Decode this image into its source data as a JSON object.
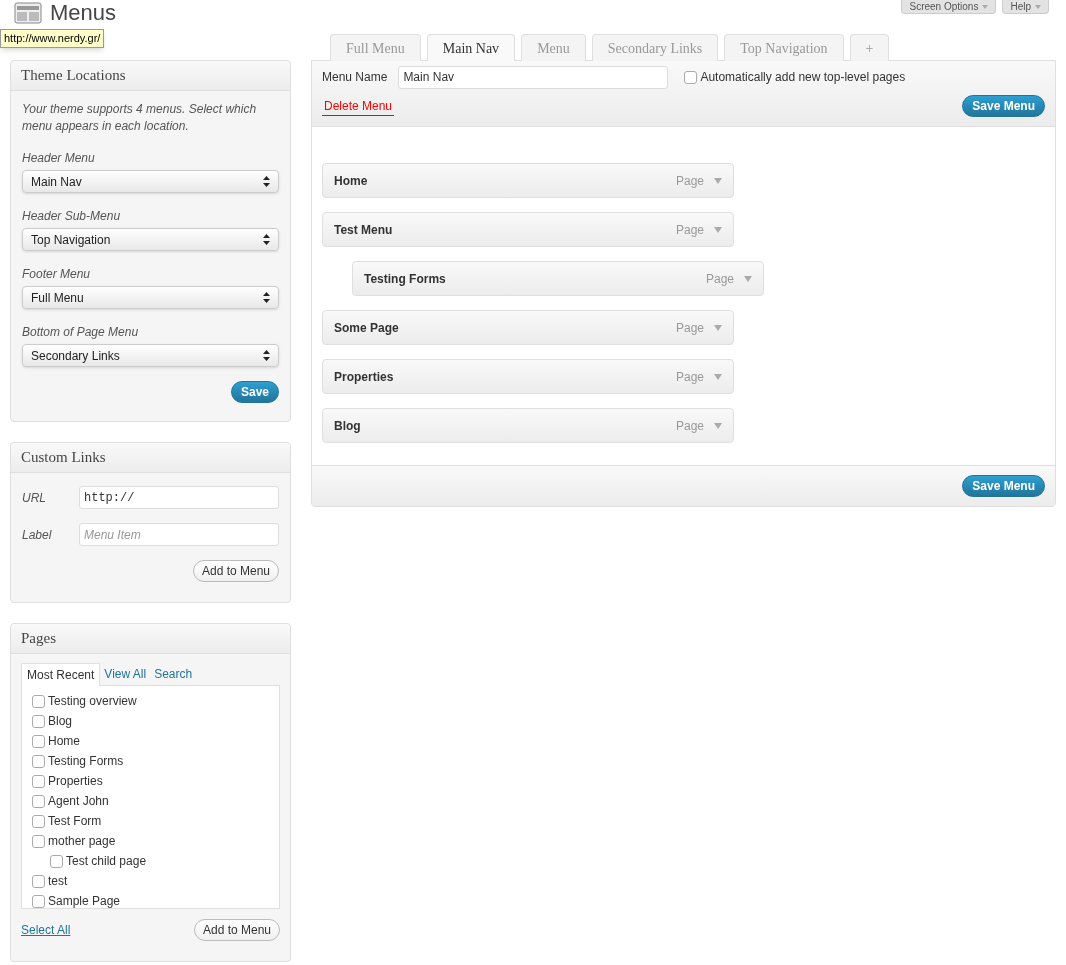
{
  "header": {
    "title": "Menus",
    "tooltip": "http://www.nerdy.gr/",
    "buttons": [
      "Screen Options",
      "Help"
    ]
  },
  "theme_locations": {
    "title": "Theme Locations",
    "description": "Your theme supports 4 menus. Select which menu appears in each location.",
    "locations": [
      {
        "label": "Header Menu",
        "value": "Main Nav"
      },
      {
        "label": "Header Sub-Menu",
        "value": "Top Navigation"
      },
      {
        "label": "Footer Menu",
        "value": "Full Menu"
      },
      {
        "label": "Bottom of Page Menu",
        "value": "Secondary Links"
      }
    ],
    "save": "Save"
  },
  "custom_links": {
    "title": "Custom Links",
    "url_label": "URL",
    "url_value": "http://",
    "label_label": "Label",
    "label_placeholder": "Menu Item",
    "add": "Add to Menu"
  },
  "pages": {
    "title": "Pages",
    "tabs": [
      {
        "label": "Most Recent",
        "selected": true
      },
      {
        "label": "View All",
        "selected": false
      },
      {
        "label": "Search",
        "selected": false
      }
    ],
    "items": [
      {
        "label": "Testing overview",
        "checked": false
      },
      {
        "label": "Blog",
        "checked": false
      },
      {
        "label": "Home",
        "checked": false
      },
      {
        "label": "Testing Forms",
        "checked": false
      },
      {
        "label": "Properties",
        "checked": false
      },
      {
        "label": "Agent John",
        "checked": false
      },
      {
        "label": "Test Form",
        "checked": false
      },
      {
        "label": "mother page",
        "checked": false,
        "children": [
          {
            "label": "Test child page",
            "checked": false
          }
        ]
      },
      {
        "label": "test",
        "checked": false
      },
      {
        "label": "Sample Page",
        "checked": false
      }
    ],
    "select_all": "Select All",
    "add": "Add to Menu"
  },
  "menu_tabs": [
    {
      "label": "Full Menu",
      "selected": false
    },
    {
      "label": "Main Nav",
      "selected": true
    },
    {
      "label": "Menu",
      "selected": false
    },
    {
      "label": "Secondary Links",
      "selected": false
    },
    {
      "label": "Top Navigation",
      "selected": false
    },
    {
      "label": "+",
      "selected": false
    }
  ],
  "editor": {
    "name_label": "Menu Name",
    "name_value": "Main Nav",
    "auto_add": {
      "label": "Automatically add new top-level pages",
      "checked": false
    },
    "delete": "Delete Menu",
    "save_top": "Save Menu",
    "save_bottom": "Save Menu",
    "items": [
      {
        "title": "Home",
        "type": "Page"
      },
      {
        "title": "Test Menu",
        "type": "Page",
        "children": [
          {
            "title": "Testing Forms",
            "type": "Page"
          }
        ]
      },
      {
        "title": "Some Page",
        "type": "Page"
      },
      {
        "title": "Properties",
        "type": "Page"
      },
      {
        "title": "Blog",
        "type": "Page"
      }
    ]
  }
}
